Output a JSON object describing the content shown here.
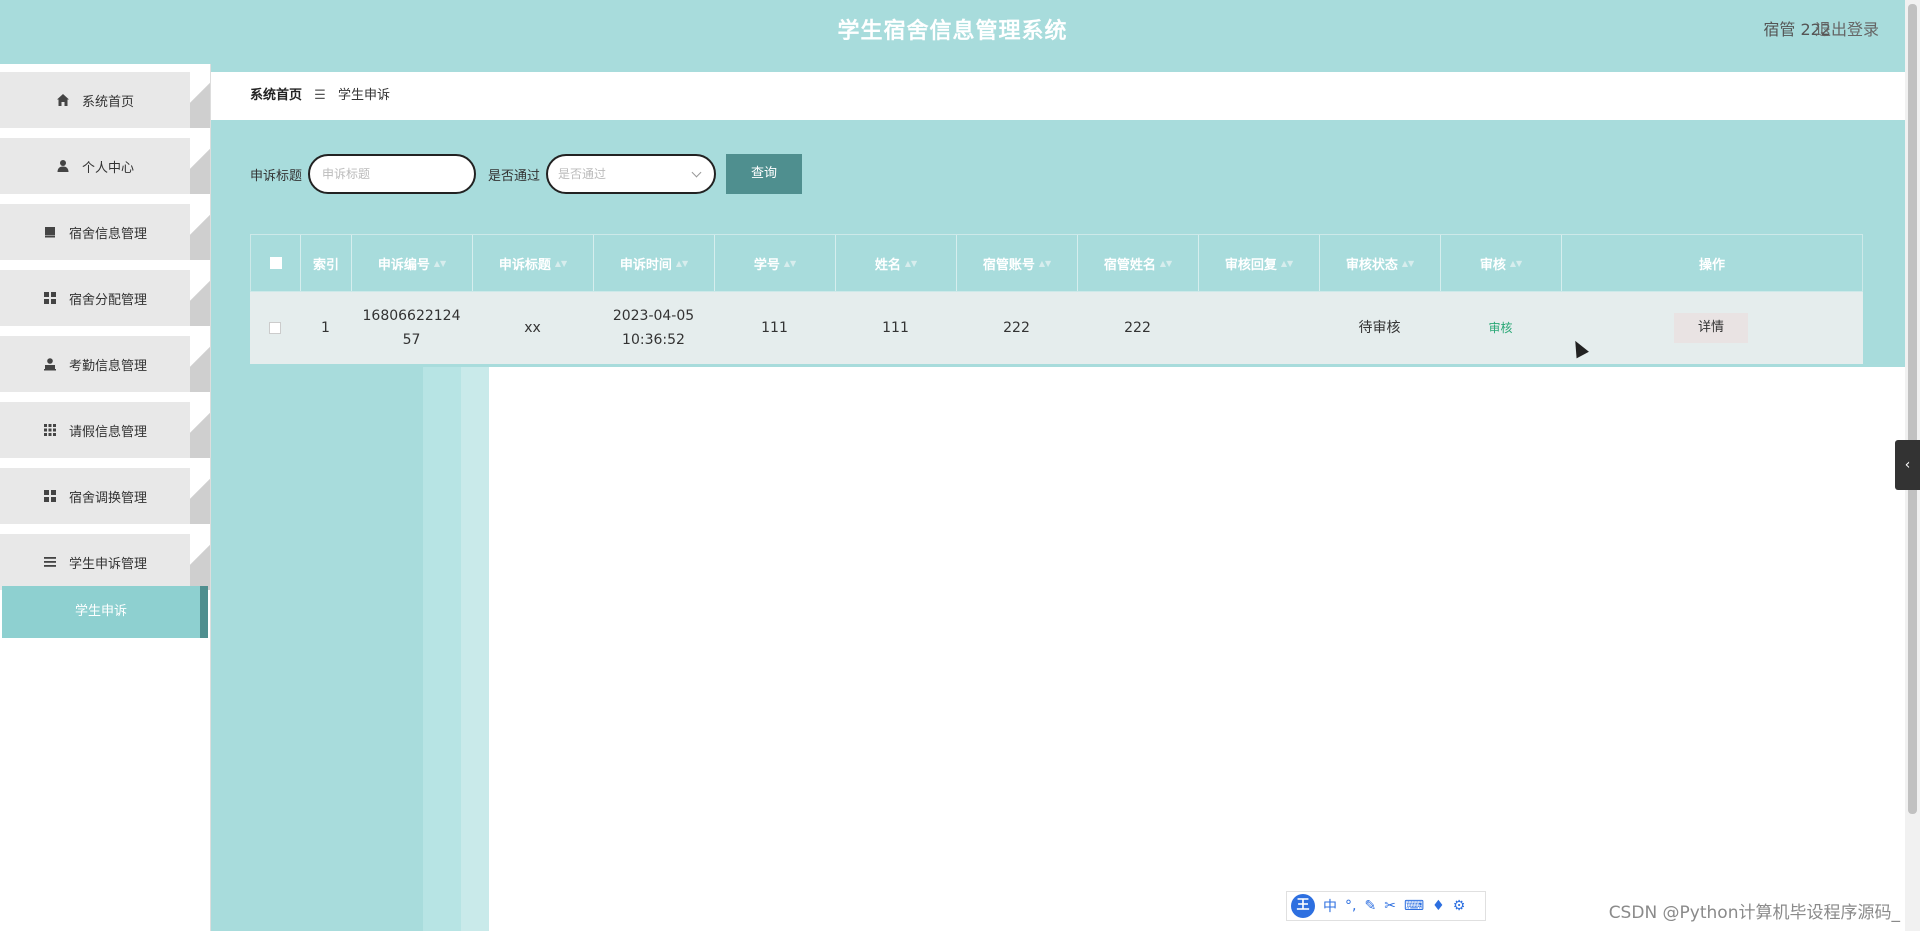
{
  "header": {
    "title": "学生宿舍信息管理系统",
    "user": "宿管 222",
    "logout": "退出登录"
  },
  "sidebar": {
    "items": [
      {
        "label": "系统首页",
        "icon": "home-icon"
      },
      {
        "label": "个人中心",
        "icon": "user-icon"
      },
      {
        "label": "宿舍信息管理",
        "icon": "book-icon"
      },
      {
        "label": "宿舍分配管理",
        "icon": "grid-icon"
      },
      {
        "label": "考勤信息管理",
        "icon": "person-icon"
      },
      {
        "label": "请假信息管理",
        "icon": "apps-icon"
      },
      {
        "label": "宿舍调换管理",
        "icon": "grid-icon"
      },
      {
        "label": "学生申诉管理",
        "icon": "list-icon"
      }
    ],
    "submenu": "学生申诉"
  },
  "breadcrumb": {
    "home": "系统首页",
    "sep": "☰",
    "current": "学生申诉"
  },
  "search": {
    "title_label": "申诉标题",
    "title_placeholder": "申诉标题",
    "pass_label": "是否通过",
    "pass_placeholder": "是否通过",
    "query_btn": "查询"
  },
  "table": {
    "headers": [
      "索引",
      "申诉编号",
      "申诉标题",
      "申诉时间",
      "学号",
      "姓名",
      "宿管账号",
      "宿管姓名",
      "审核回复",
      "审核状态",
      "审核",
      "操作"
    ],
    "rows": [
      {
        "index": "1",
        "code": "1680662212457",
        "title": "xx",
        "time": "2023-04-05 10:36:52",
        "student_no": "111",
        "name": "111",
        "manager_account": "222",
        "manager_name": "222",
        "reply": "",
        "status": "待审核",
        "audit": "审核",
        "action": "详情"
      }
    ]
  },
  "ime": {
    "logo": "王",
    "lang": "中"
  },
  "watermark": "CSDN @Python计算机毕设程序源码_",
  "colors": {
    "header_bg": "#a8dcdc",
    "accent": "#4f8f8f",
    "audit_link": "#2aa876"
  }
}
